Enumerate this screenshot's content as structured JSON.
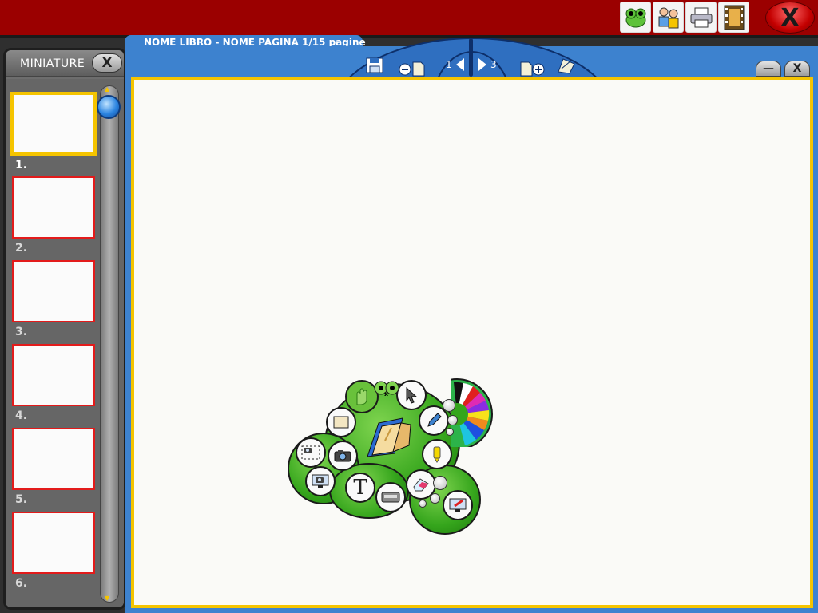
{
  "topbar": {
    "buttons": [
      {
        "name": "frog-icon",
        "glyph": "🐸"
      },
      {
        "name": "users-icon",
        "glyph": "👥"
      },
      {
        "name": "printer-icon",
        "glyph": "🖶"
      },
      {
        "name": "film-icon",
        "glyph": "🎞"
      }
    ],
    "close_label": "X"
  },
  "sidebar": {
    "title": "MINIATURE",
    "close_label": "X",
    "thumbnails": [
      {
        "num": "1.",
        "active": true
      },
      {
        "num": "2.",
        "active": false
      },
      {
        "num": "3.",
        "active": false
      },
      {
        "num": "4.",
        "active": false
      },
      {
        "num": "5.",
        "active": false
      },
      {
        "num": "6.",
        "active": false
      }
    ]
  },
  "main": {
    "tab_title": "NOME LIBRO - NOME PAGINA  1/15 pagine",
    "nav": {
      "prev_page": "1",
      "next_page": "3"
    },
    "minimize_label": "—",
    "close_label": "X"
  },
  "palette": {
    "tools": [
      {
        "name": "hand-tool-icon",
        "glyph": "✋"
      },
      {
        "name": "pointer-tool-icon",
        "glyph": "➚"
      },
      {
        "name": "pencil-tool-icon",
        "glyph": "✎"
      },
      {
        "name": "highlighter-tool-icon",
        "glyph": "▮"
      },
      {
        "name": "eraser-tool-icon",
        "glyph": "⌫"
      },
      {
        "name": "screen-capture-icon",
        "glyph": "🖥"
      },
      {
        "name": "keyboard-icon",
        "glyph": "⌨"
      },
      {
        "name": "text-tool-icon",
        "glyph": "T"
      },
      {
        "name": "monitor-camera-icon",
        "glyph": "📷"
      },
      {
        "name": "camera-icon",
        "glyph": "📷"
      },
      {
        "name": "area-capture-icon",
        "glyph": "⬚"
      },
      {
        "name": "frame-tool-icon",
        "glyph": "▭"
      }
    ],
    "colors": [
      "#111111",
      "#ffffff",
      "#e0201e",
      "#e02ab4",
      "#8a2be2",
      "#f7e11b",
      "#f08a1e",
      "#1e4fe0",
      "#1ec4e0",
      "#2cb34a"
    ]
  }
}
